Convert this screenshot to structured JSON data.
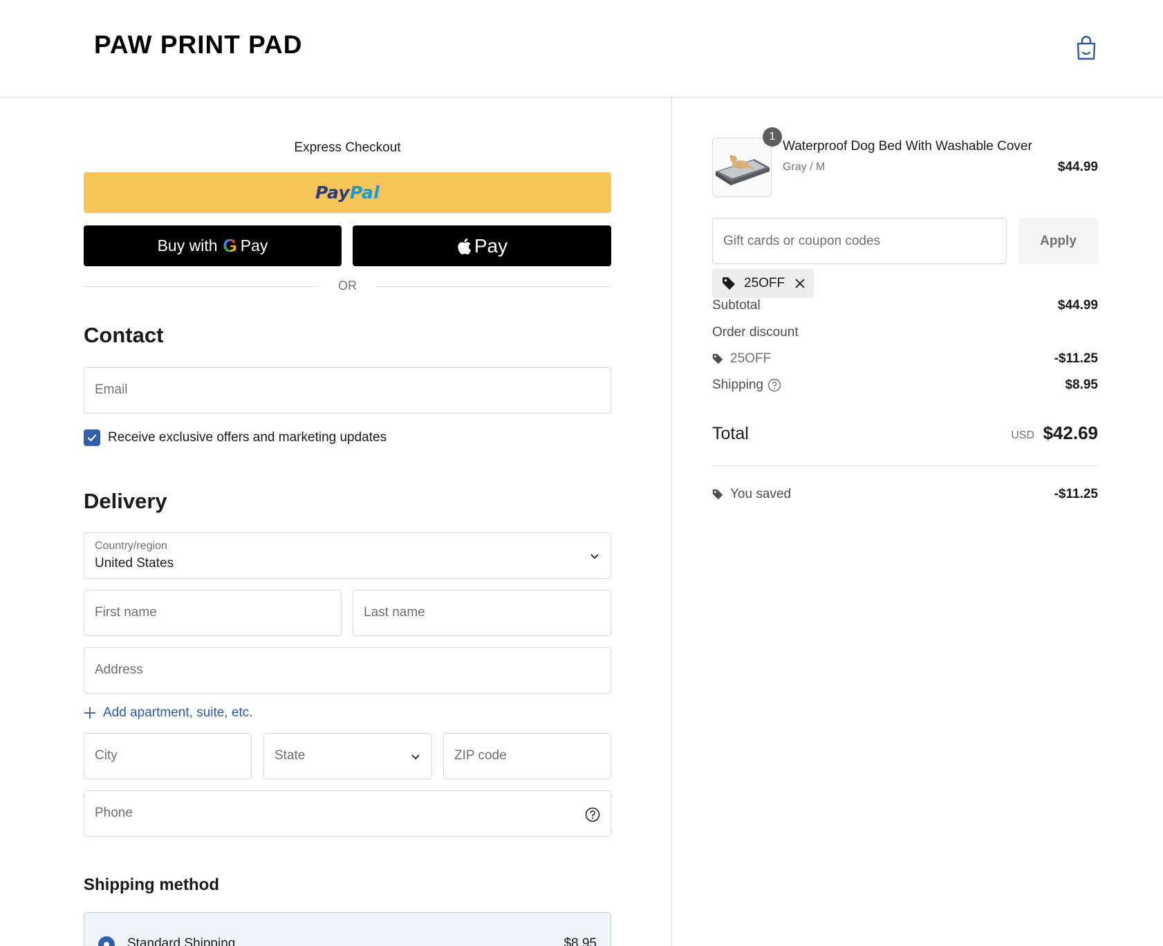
{
  "header": {
    "brand": "PAW PRINT PAD",
    "cart_icon": "shopping-bag-icon"
  },
  "express": {
    "title": "Express Checkout",
    "paypal_part1": "Pay",
    "paypal_part2": "Pal",
    "gpay_prefix": "Buy with",
    "gpay_g": "G",
    "gpay_suffix": "Pay",
    "applepay_label": "Pay",
    "or_text": "OR"
  },
  "contact": {
    "title": "Contact",
    "email_placeholder": "Email",
    "marketing_label": "Receive exclusive offers and marketing updates",
    "marketing_checked": true
  },
  "delivery": {
    "title": "Delivery",
    "country_label": "Country/region",
    "country_value": "United States",
    "first_name_placeholder": "First name",
    "last_name_placeholder": "Last name",
    "address_placeholder": "Address",
    "add_apartment": "Add apartment, suite, etc.",
    "city_placeholder": "City",
    "state_placeholder": "State",
    "zip_placeholder": "ZIP code",
    "phone_placeholder": "Phone"
  },
  "shipping_method": {
    "title": "Shipping method",
    "option_name": "Standard Shipping",
    "option_price": "$8.95"
  },
  "order": {
    "quantity": "1",
    "product_name": "Waterproof Dog Bed With Washable Cover",
    "variant": "Gray / M",
    "price": "$44.99",
    "coupon_placeholder": "Gift cards or coupon codes",
    "apply_label": "Apply",
    "applied_code": "25OFF",
    "subtotal_label": "Subtotal",
    "subtotal_value": "$44.99",
    "discount_label": "Order discount",
    "discount_code": "25OFF",
    "discount_value": "-$11.25",
    "shipping_label": "Shipping",
    "shipping_value": "$8.95",
    "total_label": "Total",
    "currency": "USD",
    "total_value": "$42.69",
    "saved_label": "You saved",
    "saved_value": "-$11.25"
  },
  "colors": {
    "paypal_yellow": "#f7c458",
    "accent_blue": "#3060aa",
    "link_blue": "#2b5aa0"
  }
}
